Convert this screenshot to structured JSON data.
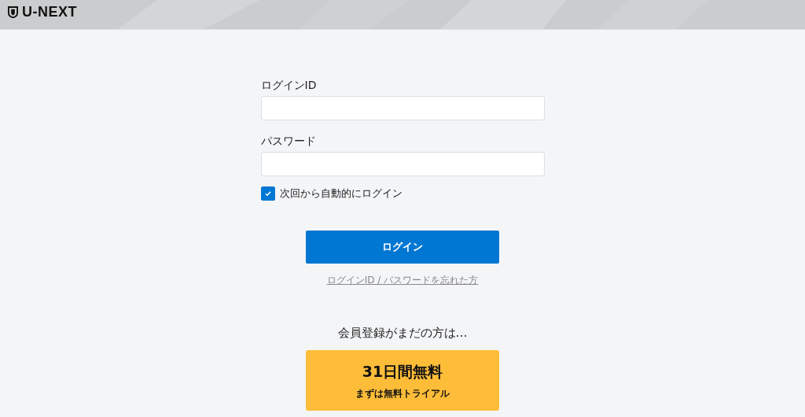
{
  "header": {
    "logo": "U-NEXT"
  },
  "form": {
    "fields": [
      {
        "label": "ログインID"
      },
      {
        "label": "パスワード"
      }
    ],
    "remember": {
      "label": "次回から自動的にログイン",
      "checked": true
    },
    "login_button": "ログイン",
    "forgot_link": "ログインID / パスワードを忘れた方"
  },
  "signup": {
    "prompt": "会員登録がまだの方は…",
    "title": "31日間無料",
    "subtitle": "まずは無料トライアル"
  }
}
